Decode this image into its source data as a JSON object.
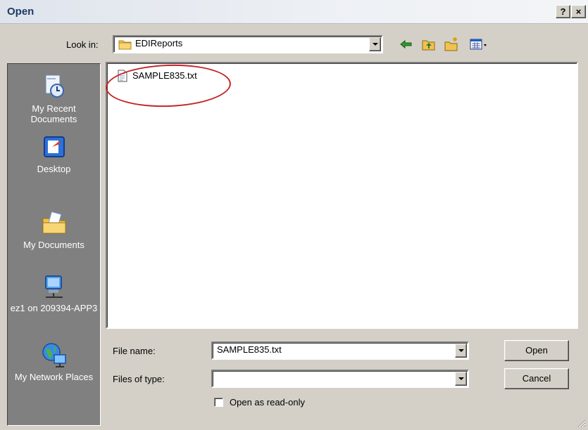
{
  "window": {
    "title": "Open",
    "help_label": "?",
    "close_label": "×"
  },
  "toolbar": {
    "look_in_label": "Look in:",
    "look_in_value": "EDIReports",
    "icons": [
      "back-icon",
      "up-folder-icon",
      "new-folder-icon",
      "view-menu-icon"
    ]
  },
  "places": [
    {
      "label": "My Recent Documents",
      "icon": "recent-documents-icon"
    },
    {
      "label": "Desktop",
      "icon": "desktop-icon"
    },
    {
      "label": "My Documents",
      "icon": "my-documents-icon"
    },
    {
      "label": "ez1 on 209394-APP3",
      "icon": "network-drive-icon"
    },
    {
      "label": "My Network Places",
      "icon": "network-places-icon"
    }
  ],
  "files": [
    {
      "name": "SAMPLE835.txt",
      "icon": "text-file-icon"
    }
  ],
  "form": {
    "file_name_label": "File name:",
    "file_name_value": "SAMPLE835.txt",
    "files_of_type_label": "Files of type:",
    "files_of_type_value": "",
    "read_only_label": "Open as read-only",
    "read_only_checked": false
  },
  "buttons": {
    "open": "Open",
    "cancel": "Cancel"
  },
  "colors": {
    "annotation_circle": "#c42525",
    "places_bar": "#808080",
    "dialog_face": "#d4d0c8"
  }
}
